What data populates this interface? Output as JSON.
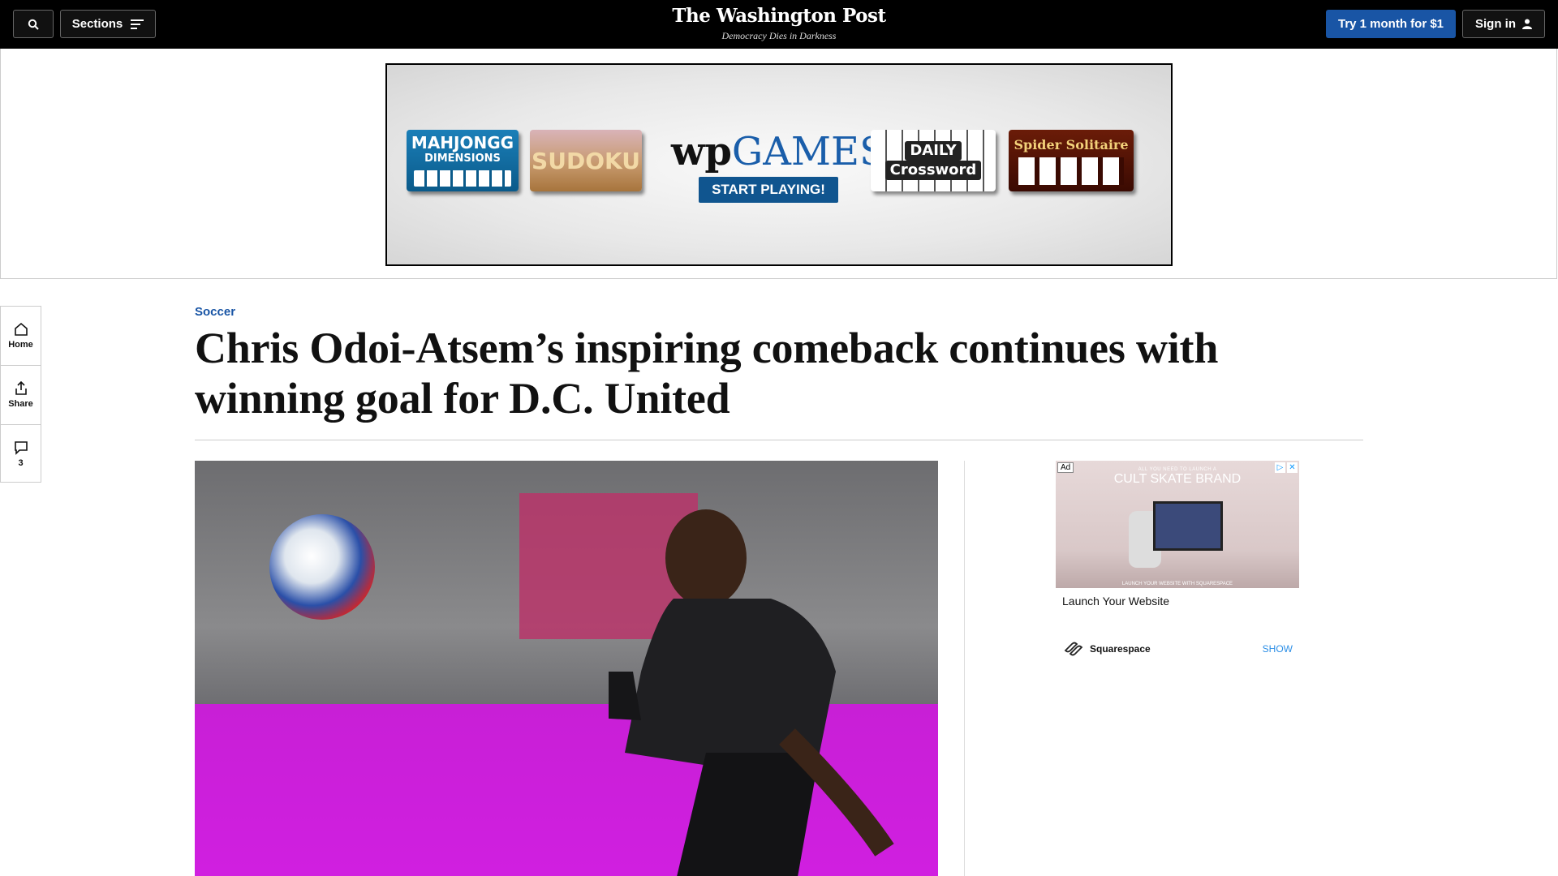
{
  "nav": {
    "sections_label": "Sections",
    "logo": "The Washington Post",
    "tagline": "Democracy Dies in Darkness",
    "subscribe_label": "Try 1 month for $1",
    "signin_label": "Sign in"
  },
  "games_ad": {
    "mahjong_title": "MAHJONGG",
    "mahjong_sub": "DIMENSIONS",
    "sudoku_title": "SUDOKU",
    "wp_mark": "wp",
    "games_word": "GAMES",
    "cta_label": "START PLAYING!",
    "crossword_line1": "DAILY",
    "crossword_line2": "Crossword",
    "spider_title": "Spider Solitaire"
  },
  "rail": {
    "home_label": "Home",
    "share_label": "Share",
    "comment_count": "3"
  },
  "article": {
    "kicker": "Soccer",
    "headline": "Chris Odoi-Atsem’s inspiring comeback continues with winning goal for D.C. United"
  },
  "sidebar_ad": {
    "badge": "Ad",
    "image_small_text": "ALL YOU NEED TO LAUNCH A",
    "image_big_text": "CULT SKATE BRAND",
    "image_footer_text": "LAUNCH YOUR WEBSITE WITH  SQUARESPACE",
    "title": "Launch Your Website",
    "brand": "Squarespace",
    "cta": "SHOW"
  },
  "colors": {
    "accent_blue": "#1955a5",
    "topbar": "#000000",
    "show_link": "#2b8ee6"
  }
}
